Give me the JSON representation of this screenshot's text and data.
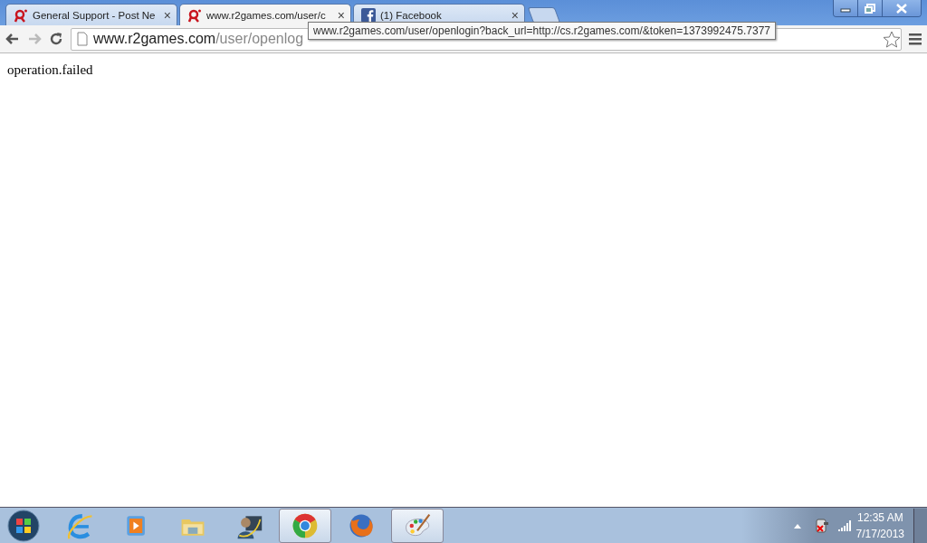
{
  "tabs": [
    {
      "title": "General Support - Post Ne",
      "kind": "r2",
      "selected": false,
      "close": "×"
    },
    {
      "title": "www.r2games.com/user/c",
      "kind": "r2",
      "selected": true,
      "close": "×"
    },
    {
      "title": "(1) Facebook",
      "kind": "facebook",
      "selected": false,
      "close": "×"
    }
  ],
  "toolbar": {
    "back_enabled": true,
    "forward_enabled": false,
    "address_host": "www.r2games.com",
    "address_path": "/user/openlog"
  },
  "tooltip": "www.r2games.com/user/openlogin?back_url=http://cs.r2games.com/&token=1373992475.7377",
  "page": {
    "message": "operation.failed"
  },
  "taskbar": {
    "apps": [
      {
        "kind": "ie",
        "running": false
      },
      {
        "kind": "media",
        "running": false
      },
      {
        "kind": "folder",
        "running": false
      },
      {
        "kind": "person",
        "running": false
      },
      {
        "kind": "chrome",
        "running": true
      },
      {
        "kind": "firefox",
        "running": false
      },
      {
        "kind": "paint",
        "running": true
      }
    ],
    "time": "12:35 AM",
    "date": "7/17/2013"
  }
}
